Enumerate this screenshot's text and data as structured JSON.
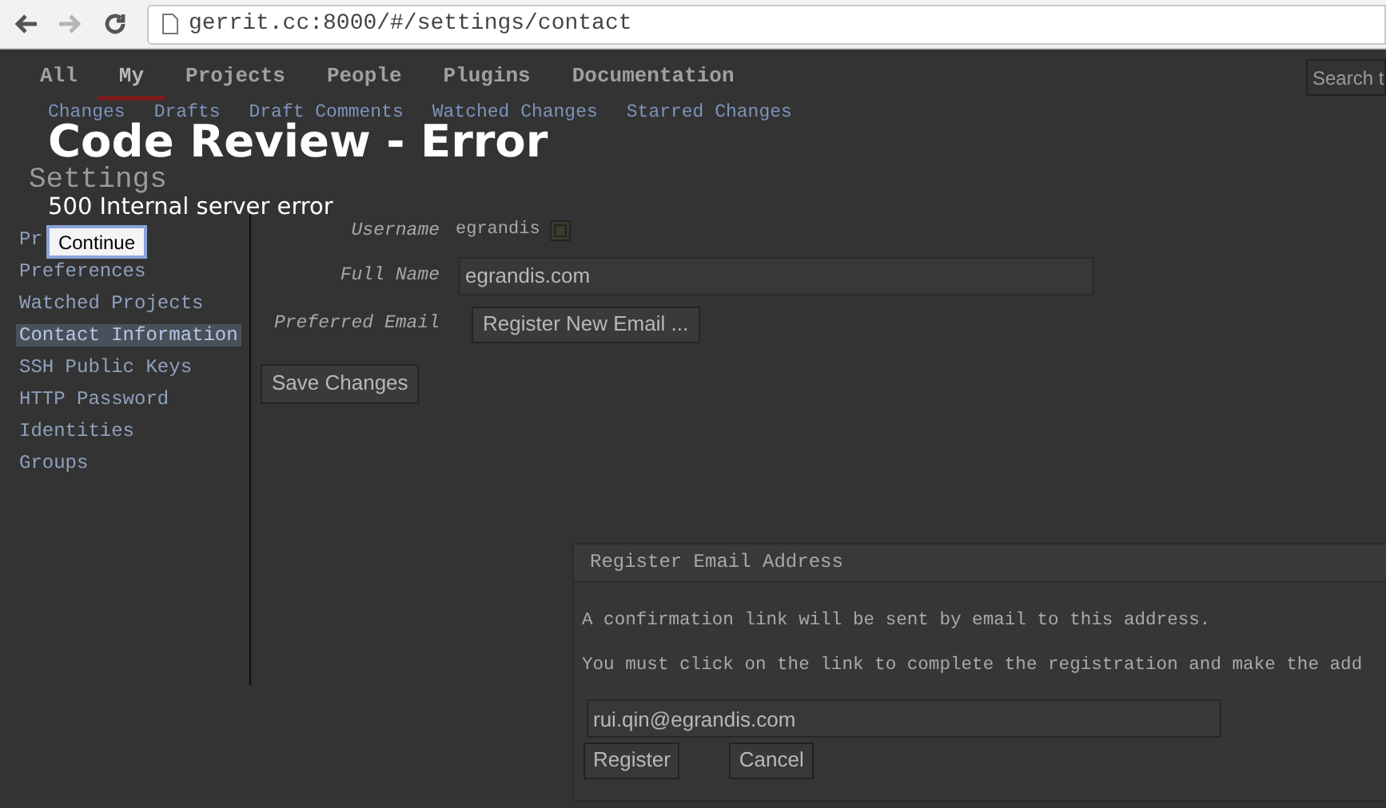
{
  "browser": {
    "url": "gerrit.cc:8000/#/settings/contact"
  },
  "top_nav": [
    {
      "label": "All",
      "selected": false
    },
    {
      "label": "My",
      "selected": true
    },
    {
      "label": "Projects",
      "selected": false
    },
    {
      "label": "People",
      "selected": false
    },
    {
      "label": "Plugins",
      "selected": false
    },
    {
      "label": "Documentation",
      "selected": false
    }
  ],
  "search": {
    "placeholder": "Search t"
  },
  "sub_nav": [
    "Changes",
    "Drafts",
    "Draft Comments",
    "Watched Changes",
    "Starred Changes"
  ],
  "page_title": "Settings",
  "sidebar": {
    "items": [
      {
        "label": "Pr",
        "selected": false
      },
      {
        "label": "Preferences",
        "selected": false
      },
      {
        "label": "Watched Projects",
        "selected": false
      },
      {
        "label": "Contact Information",
        "selected": true
      },
      {
        "label": "SSH Public Keys",
        "selected": false
      },
      {
        "label": "HTTP Password",
        "selected": false
      },
      {
        "label": "Identities",
        "selected": false
      },
      {
        "label": "Groups",
        "selected": false
      }
    ]
  },
  "form": {
    "username_label": "Username",
    "username": "egrandis",
    "full_name_label": "Full Name",
    "full_name": "egrandis.com",
    "preferred_email_label": "Preferred Email",
    "register_button": "Register New Email ...",
    "save_button": "Save Changes"
  },
  "dialog": {
    "title": "Register Email Address",
    "lines": [
      "A confirmation link will be sent by email to this address.",
      "You must click on the link to complete the registration and make the add"
    ],
    "email": "rui.qin@egrandis.com",
    "buttons": [
      "Register",
      "Cancel"
    ]
  },
  "error": {
    "title": "Code Review - Error",
    "message": "500 Internal server error",
    "button": "Continue"
  }
}
